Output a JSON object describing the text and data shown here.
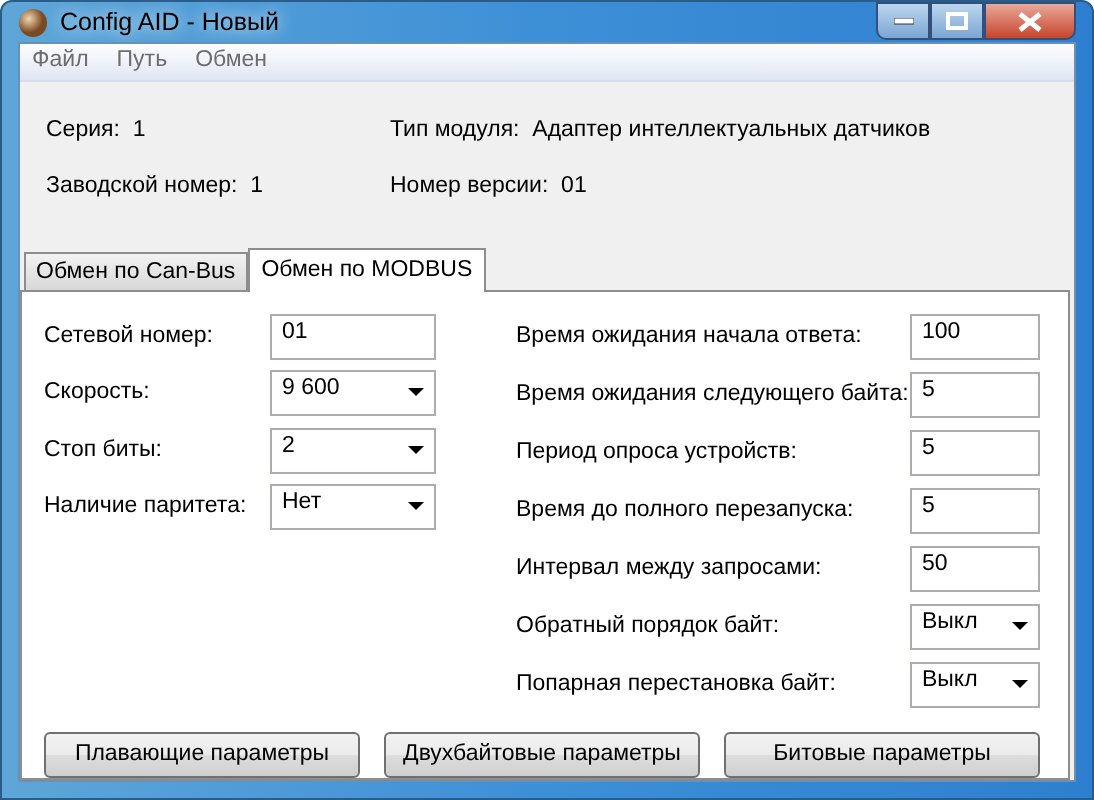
{
  "window": {
    "title": "Config AID - Новый"
  },
  "menu": [
    "Файл",
    "Путь",
    "Обмен"
  ],
  "info": [
    {
      "label": "Серия:",
      "value": "1"
    },
    {
      "label": "Тип модуля:",
      "value": "Адаптер интеллектуальных датчиков"
    },
    {
      "label": "Заводской номер:",
      "value": "1"
    },
    {
      "label": "Номер версии:",
      "value": "01"
    }
  ],
  "tabs": [
    {
      "label": "Обмен по Can-Bus",
      "selected": false
    },
    {
      "label": "Обмен по MODBUS",
      "selected": true
    }
  ],
  "left_fields": [
    {
      "label": "Сетевой номер:",
      "kind": "text",
      "value": "01"
    },
    {
      "label": "Скорость:",
      "kind": "select",
      "value": "9 600"
    },
    {
      "label": "Стоп биты:",
      "kind": "select",
      "value": "2"
    },
    {
      "label": "Наличие паритета:",
      "kind": "select",
      "value": "Нет"
    }
  ],
  "right_fields": [
    {
      "label": "Время ожидания начала ответа:",
      "kind": "text",
      "value": "100"
    },
    {
      "label": "Время ожидания следующего байта:",
      "kind": "text",
      "value": "5"
    },
    {
      "label": "Период опроса устройств:",
      "kind": "text",
      "value": "5"
    },
    {
      "label": "Время до полного перезапуска:",
      "kind": "text",
      "value": "5"
    },
    {
      "label": "Интервал между запросами:",
      "kind": "text",
      "value": "50"
    },
    {
      "label": "Обратный порядок байт:",
      "kind": "select",
      "value": "Выкл"
    },
    {
      "label": "Попарная перестановка байт:",
      "kind": "select",
      "value": "Выкл"
    }
  ],
  "buttons": [
    "Плавающие параметры",
    "Двухбайтовые параметры",
    "Битовые параметры"
  ]
}
